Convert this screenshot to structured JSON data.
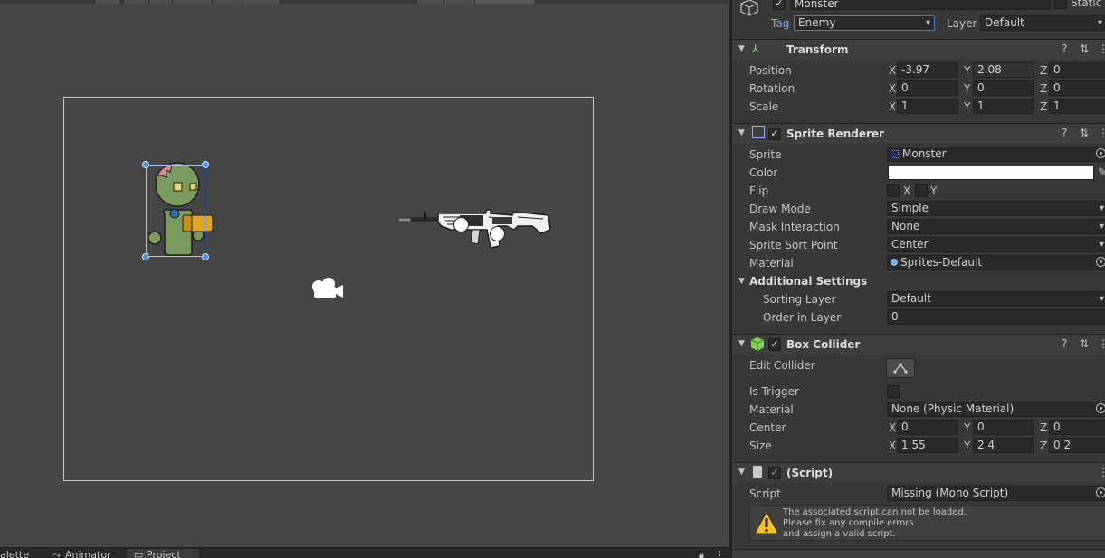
{
  "object": {
    "name": "Monster",
    "static_label": "Static",
    "tag_label": "Tag",
    "tag_value": "Enemy",
    "layer_label": "Layer",
    "layer_value": "Default"
  },
  "transform": {
    "title": "Transform",
    "position": {
      "label": "Position",
      "x": "-3.97",
      "y": "2.08",
      "z": "0"
    },
    "rotation": {
      "label": "Rotation",
      "x": "0",
      "y": "0",
      "z": "0"
    },
    "scale": {
      "label": "Scale",
      "x": "1",
      "y": "1",
      "z": "1"
    }
  },
  "sprite_renderer": {
    "title": "Sprite Renderer",
    "sprite_label": "Sprite",
    "sprite_value": "Monster",
    "color_label": "Color",
    "color_value": "#ffffff",
    "flip_label": "Flip",
    "flip_x": "X",
    "flip_y": "Y",
    "draw_mode_label": "Draw Mode",
    "draw_mode_value": "Simple",
    "mask_label": "Mask Interaction",
    "mask_value": "None",
    "sort_point_label": "Sprite Sort Point",
    "sort_point_value": "Center",
    "material_label": "Material",
    "material_value": "Sprites-Default",
    "additional_title": "Additional Settings",
    "sorting_layer_label": "Sorting Layer",
    "sorting_layer_value": "Default",
    "order_label": "Order in Layer",
    "order_value": "0"
  },
  "box_collider": {
    "title": "Box Collider",
    "edit_label": "Edit Collider",
    "trigger_label": "Is Trigger",
    "material_label": "Material",
    "material_value": "None (Physic Material)",
    "center": {
      "label": "Center",
      "x": "0",
      "y": "0",
      "z": "0"
    },
    "size": {
      "label": "Size",
      "x": "1.55",
      "y": "2.4",
      "z": "0.2"
    }
  },
  "script": {
    "title": "(Script)",
    "label": "Script",
    "value": "Missing (Mono Script)",
    "warning_line1": "The associated script can not be loaded.",
    "warning_line2": "Please fix any compile errors",
    "warning_line3": "and assign a valid script."
  },
  "bottom_tabs": [
    "alette",
    "Animator",
    "Project"
  ],
  "axis": {
    "x": "X",
    "y": "Y",
    "z": "Z"
  }
}
